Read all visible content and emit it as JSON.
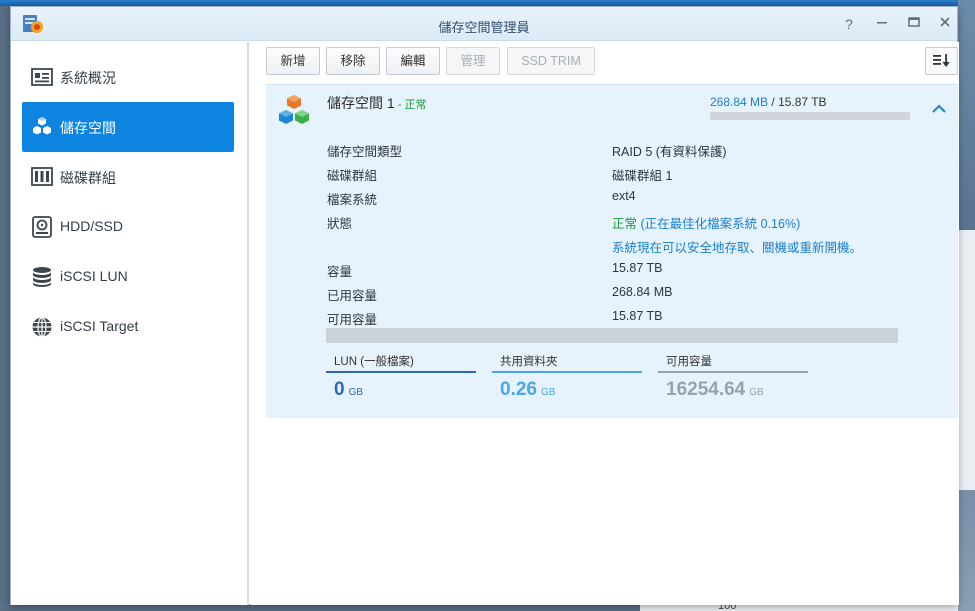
{
  "window": {
    "title": "儲存空間管理員",
    "controls": {
      "help_icon": "?",
      "minimize_icon": "minimize-icon",
      "maximize_icon": "maximize-icon",
      "close_icon": "close-icon"
    }
  },
  "sidebar": {
    "items": [
      {
        "label": "系統概況",
        "icon": "overview-icon",
        "active": false
      },
      {
        "label": "儲存空間",
        "icon": "volume-cubes-icon",
        "active": true
      },
      {
        "label": "磁碟群組",
        "icon": "disk-group-icon",
        "active": false
      },
      {
        "label": "HDD/SSD",
        "icon": "hdd-icon",
        "active": false
      },
      {
        "label": "iSCSI LUN",
        "icon": "lun-stack-icon",
        "active": false
      },
      {
        "label": "iSCSI Target",
        "icon": "globe-icon",
        "active": false
      }
    ]
  },
  "toolbar": {
    "create": "新增",
    "remove": "移除",
    "edit": "編輯",
    "manage": "管理",
    "ssd_trim": "SSD TRIM"
  },
  "volume": {
    "name": "儲存空間 1",
    "status_separator": " - ",
    "status": "正常",
    "used": "268.84 MB",
    "usage_separator": " / ",
    "total": "15.87 TB",
    "usage_fraction": 0.0,
    "properties": [
      {
        "label": "儲存空間類型",
        "value": "RAID 5 (有資料保護)"
      },
      {
        "label": "磁碟群組",
        "value": "磁碟群組 1"
      },
      {
        "label": "檔案系統",
        "value": "ext4"
      },
      {
        "label": "狀態",
        "value_status": "正常",
        "value_detail": " (正在最佳化檔案系統 0.16%)"
      },
      {
        "label": "",
        "value": "系統現在可以安全地存取、關機或重新開機。"
      },
      {
        "label": "容量",
        "value": "15.87 TB"
      },
      {
        "label": "已用容量",
        "value": "268.84 MB"
      },
      {
        "label": "可用容量",
        "value": "15.87 TB"
      }
    ],
    "stats": [
      {
        "label": "LUN (一般檔案)",
        "value": "0",
        "unit": "GB",
        "color": "#2e6bb0"
      },
      {
        "label": "共用資料夾",
        "value": "0.26",
        "unit": "GB",
        "color": "#4aa6e8"
      },
      {
        "label": "可用容量",
        "value": "16254.64",
        "unit": "GB",
        "color": "#98a2ac"
      }
    ]
  },
  "desktop": {
    "bottom_number": "100"
  },
  "colors": {
    "accent": "#0d84e0",
    "status_ok": "#1a9a35",
    "link_blue": "#1b80d2",
    "panel_bg": "#e6f3fc"
  }
}
